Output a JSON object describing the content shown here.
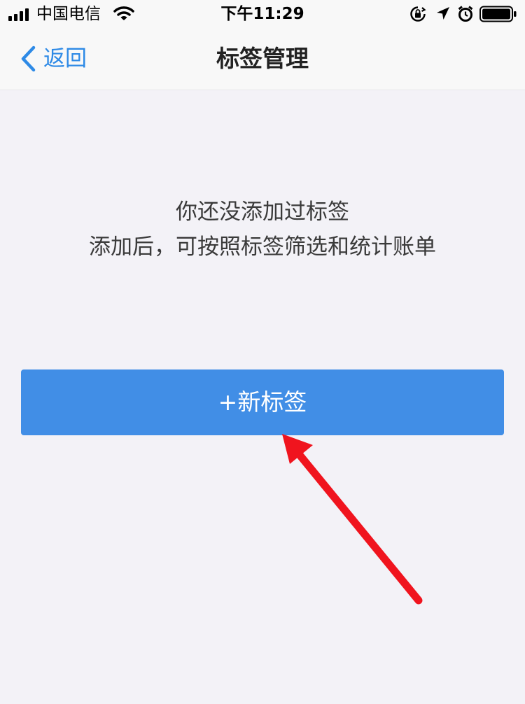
{
  "status_bar": {
    "carrier": "中国电信",
    "time": "下午11:29"
  },
  "nav": {
    "back_label": "返回",
    "title": "标签管理"
  },
  "empty_state": {
    "line1": "你还没添加过标签",
    "line2": "添加后，可按照标签筛选和统计账单"
  },
  "new_tag_button": {
    "label": "+新标签"
  },
  "colors": {
    "accent": "#418ee6",
    "link": "#2e8ae6",
    "background": "#f3f2f7",
    "annotation_arrow": "#f0141e"
  }
}
